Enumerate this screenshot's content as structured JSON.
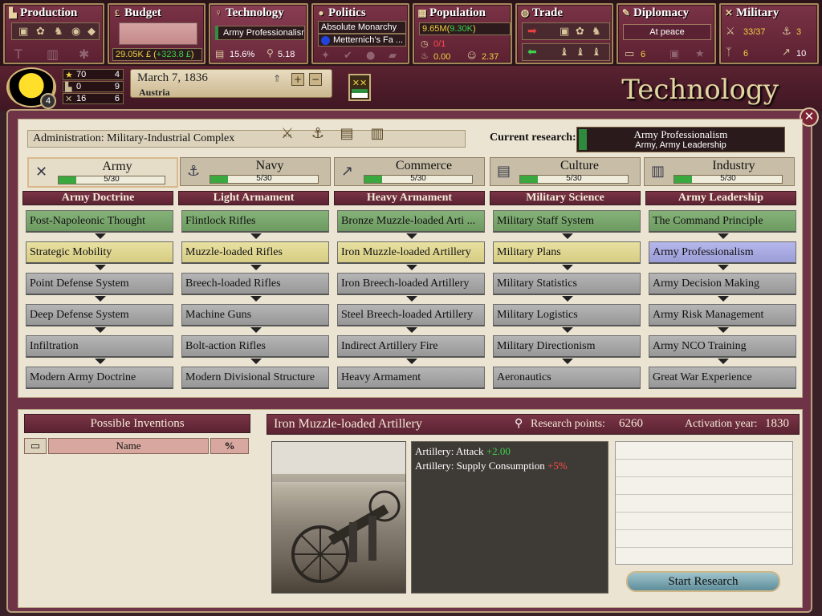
{
  "topbar": {
    "production": {
      "title": "Production"
    },
    "budget": {
      "title": "Budget",
      "funds": "29.05K £",
      "delta": "+323.8 £"
    },
    "technology": {
      "title": "Technology",
      "current": "Army Professionalism",
      "literacy": "15.6%",
      "research_points": "5.18"
    },
    "politics": {
      "title": "Politics",
      "government": "Absolute Monarchy",
      "party": "Metternich's Fa ..."
    },
    "population": {
      "title": "Population",
      "total": "9.65M",
      "growth": "9.30K",
      "ratio": "0/1",
      "stat1": "0.00",
      "stat2": "2.37"
    },
    "trade": {
      "title": "Trade"
    },
    "diplomacy": {
      "title": "Diplomacy",
      "status": "At peace",
      "count": "6"
    },
    "military": {
      "title": "Military",
      "army": "33/37",
      "navy": "3",
      "m1": "6",
      "m2": "10"
    }
  },
  "header": {
    "rank": "4",
    "stats": [
      {
        "icon": "star-icon",
        "value": "70",
        "rank": "4"
      },
      {
        "icon": "factory-icon",
        "value": "0",
        "rank": "9"
      },
      {
        "icon": "swords-icon",
        "value": "16",
        "rank": "6"
      }
    ],
    "date": "March 7, 1836",
    "country": "Austria",
    "page_title": "Technology"
  },
  "admin": {
    "label": "Administration:",
    "value": "Military-Industrial Complex"
  },
  "current_research": {
    "label": "Current research:",
    "name": "Army Professionalism",
    "sub": "Army, Army Leadership"
  },
  "categories": [
    {
      "name": "Army",
      "progress": "5/30",
      "icon": "crossed-swords-icon",
      "fill": 0.1667,
      "selected": true
    },
    {
      "name": "Navy",
      "progress": "5/30",
      "icon": "anchor-icon",
      "fill": 0.1667
    },
    {
      "name": "Commerce",
      "progress": "5/30",
      "icon": "chart-icon",
      "fill": 0.1667
    },
    {
      "name": "Culture",
      "progress": "5/30",
      "icon": "book-icon",
      "fill": 0.1667
    },
    {
      "name": "Industry",
      "progress": "5/30",
      "icon": "factory-icon",
      "fill": 0.1667
    }
  ],
  "columns": [
    {
      "title": "Army Doctrine",
      "techs": [
        {
          "name": "Post-Napoleonic Thought",
          "state": "researched"
        },
        {
          "name": "Strategic Mobility",
          "state": "available"
        },
        {
          "name": "Point Defense System",
          "state": "locked"
        },
        {
          "name": "Deep Defense System",
          "state": "locked"
        },
        {
          "name": "Infiltration",
          "state": "locked"
        },
        {
          "name": "Modern Army Doctrine",
          "state": "locked"
        }
      ]
    },
    {
      "title": "Light Armament",
      "techs": [
        {
          "name": "Flintlock Rifles",
          "state": "researched"
        },
        {
          "name": "Muzzle-loaded Rifles",
          "state": "available"
        },
        {
          "name": "Breech-loaded Rifles",
          "state": "locked"
        },
        {
          "name": "Machine Guns",
          "state": "locked"
        },
        {
          "name": "Bolt-action Rifles",
          "state": "locked"
        },
        {
          "name": "Modern Divisional Structure",
          "state": "locked"
        }
      ]
    },
    {
      "title": "Heavy Armament",
      "techs": [
        {
          "name": "Bronze Muzzle-loaded Arti ...",
          "state": "researched"
        },
        {
          "name": "Iron Muzzle-loaded Artillery",
          "state": "available"
        },
        {
          "name": "Iron Breech-loaded Artillery",
          "state": "locked"
        },
        {
          "name": "Steel Breech-loaded Artillery",
          "state": "locked"
        },
        {
          "name": "Indirect Artillery Fire",
          "state": "locked"
        },
        {
          "name": "Heavy Armament",
          "state": "locked"
        }
      ]
    },
    {
      "title": "Military Science",
      "techs": [
        {
          "name": "Military Staff System",
          "state": "researched"
        },
        {
          "name": "Military Plans",
          "state": "available"
        },
        {
          "name": "Military Statistics",
          "state": "locked"
        },
        {
          "name": "Military Logistics",
          "state": "locked"
        },
        {
          "name": "Military Directionism",
          "state": "locked"
        },
        {
          "name": "Aeronautics",
          "state": "locked"
        }
      ]
    },
    {
      "title": "Army Leadership",
      "techs": [
        {
          "name": "The Command Principle",
          "state": "researched"
        },
        {
          "name": "Army Professionalism",
          "state": "current"
        },
        {
          "name": "Army Decision Making",
          "state": "locked"
        },
        {
          "name": "Army Risk Management",
          "state": "locked"
        },
        {
          "name": "Army NCO Training",
          "state": "locked"
        },
        {
          "name": "Great War Experience",
          "state": "locked"
        }
      ]
    }
  ],
  "inventions": {
    "title": "Possible Inventions",
    "col_name": "Name",
    "col_pct": "%"
  },
  "details": {
    "name": "Iron Muzzle-loaded Artillery",
    "rp_label": "Research points:",
    "rp_value": "6260",
    "year_label": "Activation year:",
    "year_value": "1830",
    "effects": [
      {
        "label": "Artillery: Attack",
        "value": "+2.00",
        "type": "pos"
      },
      {
        "label": "Artillery: Supply Consumption",
        "value": "+5%",
        "type": "neg"
      }
    ],
    "button": "Start Research"
  },
  "colors": {
    "accent": "#6e3346",
    "researched": "#7aa66d",
    "available": "#ded392",
    "current": "#a8aae0",
    "locked": "#a6a6a6"
  }
}
